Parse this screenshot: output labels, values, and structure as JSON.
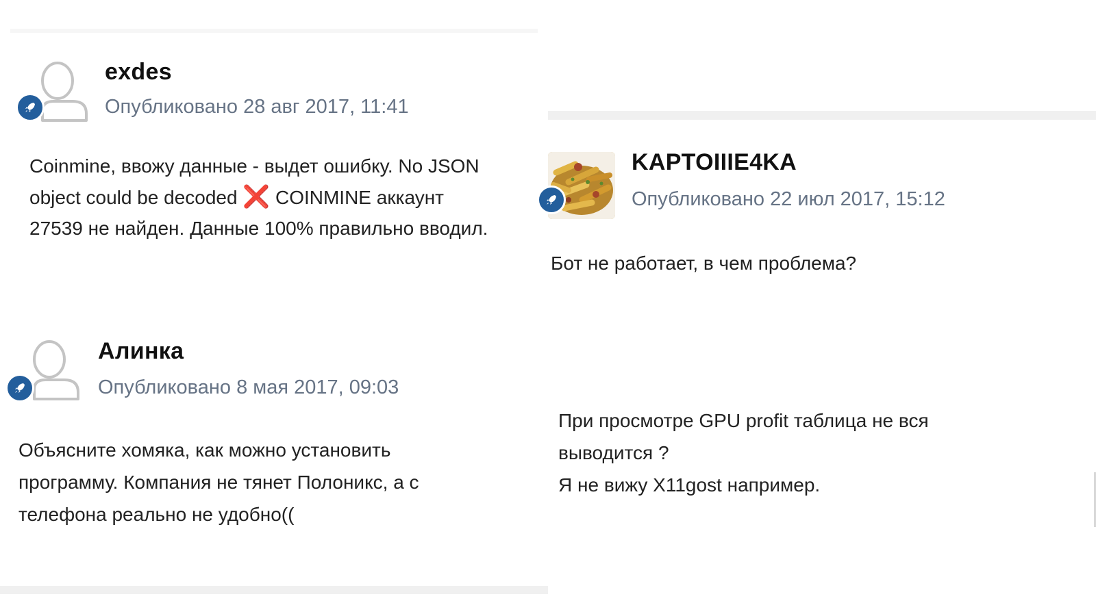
{
  "posts": [
    {
      "author": "exdes",
      "date": "Опубликовано 28 авг 2017, 11:41",
      "body": {
        "line1": "Coinmine, ввожу данные - выдет ошибку. No JSON",
        "line2_a": "object could be decoded",
        "line2_icon": "❌",
        "line2_b": "COINMINE аккаунт",
        "line3": "27539 не найден. Данные 100% правильно вводил."
      },
      "avatar": "default-user-icon",
      "badge_icon": "rocket-icon"
    },
    {
      "author": "KAPTOIIIE4KA",
      "date": "Опубликовано 22 июл 2017, 15:12",
      "body": {
        "line1": "Бот не работает, в чем проблема?"
      },
      "avatar": "fried-potatoes-photo",
      "badge_icon": "rocket-icon"
    },
    {
      "author": "Алинка",
      "date": "Опубликовано 8 мая 2017, 09:03",
      "body": {
        "line1": "Объясните хомяка, как можно установить",
        "line2": "программу. Компания не тянет Полоникс, а с",
        "line3": "телефона реально не удобно(("
      },
      "avatar": "default-user-icon",
      "badge_icon": "rocket-icon"
    },
    {
      "body": {
        "line1": "При просмотре GPU profit таблица не вся",
        "line2": "выводится ?",
        "line3": "Я не вижу X11gost например."
      }
    }
  ],
  "colors": {
    "badge": "#235e9c",
    "date_text": "#667385",
    "author_text": "#111111",
    "error_icon": "#e02424"
  }
}
